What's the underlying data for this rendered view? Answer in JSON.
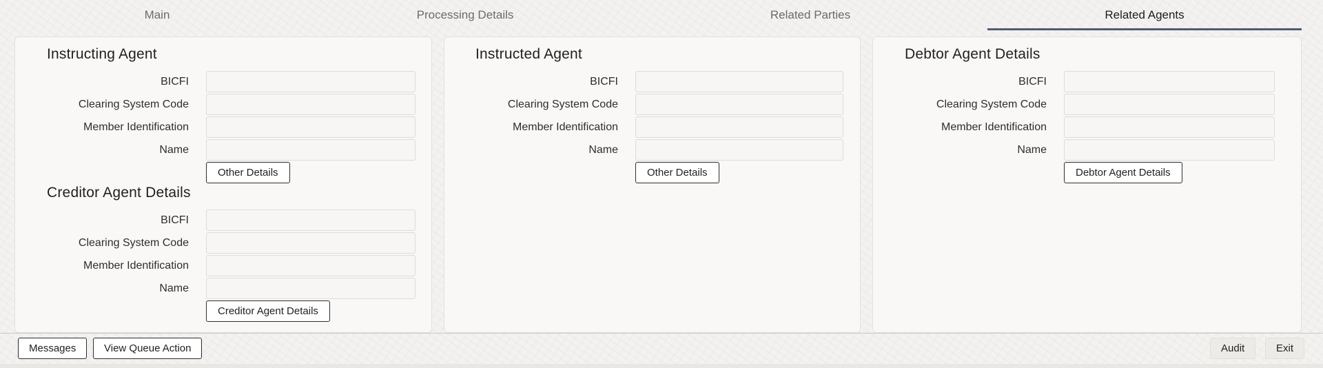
{
  "tabs": [
    {
      "label": "Main",
      "active": false
    },
    {
      "label": "Processing Details",
      "active": false
    },
    {
      "label": "Related Parties",
      "active": false
    },
    {
      "label": "Related Agents",
      "active": true
    }
  ],
  "field_labels": {
    "bicfi": "BICFI",
    "clearing_system_code": "Clearing System Code",
    "member_identification": "Member Identification",
    "name": "Name"
  },
  "instructing_agent": {
    "title": "Instructing Agent",
    "bicfi": "",
    "clearing_system_code": "",
    "member_identification": "",
    "name": "",
    "button": "Other Details"
  },
  "creditor_agent": {
    "title": "Creditor Agent Details",
    "bicfi": "",
    "clearing_system_code": "",
    "member_identification": "",
    "name": "",
    "button": "Creditor Agent Details"
  },
  "instructed_agent": {
    "title": "Instructed Agent",
    "bicfi": "",
    "clearing_system_code": "",
    "member_identification": "",
    "name": "",
    "button": "Other Details"
  },
  "debtor_agent": {
    "title": "Debtor Agent Details",
    "bicfi": "",
    "clearing_system_code": "",
    "member_identification": "",
    "name": "",
    "button": "Debtor Agent Details"
  },
  "footer": {
    "messages": "Messages",
    "view_queue_action": "View Queue Action",
    "audit": "Audit",
    "exit": "Exit"
  }
}
